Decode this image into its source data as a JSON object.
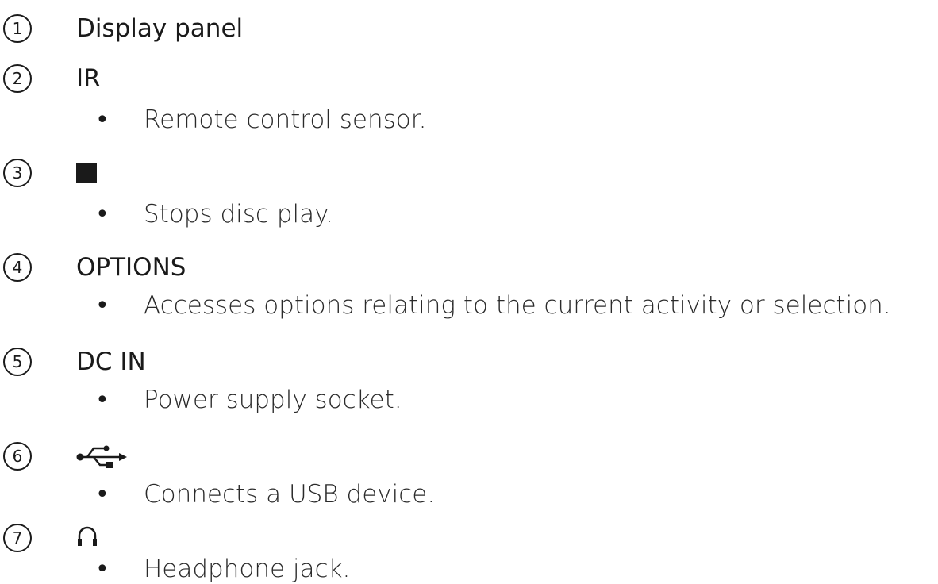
{
  "items": [
    {
      "number": "1",
      "label": "Display panel"
    },
    {
      "number": "2",
      "label": "IR",
      "description": "Remote control sensor."
    },
    {
      "number": "3",
      "icon": "stop-icon",
      "description": "Stops disc play."
    },
    {
      "number": "4",
      "label": "OPTIONS",
      "description": "Accesses options relating to the current activity or selection."
    },
    {
      "number": "5",
      "label": "DC IN",
      "description": "Power supply socket."
    },
    {
      "number": "6",
      "icon": "usb-icon",
      "description": "Connects a USB device."
    },
    {
      "number": "7",
      "icon": "headphone-icon",
      "description": "Headphone jack."
    }
  ],
  "bullet": "•"
}
